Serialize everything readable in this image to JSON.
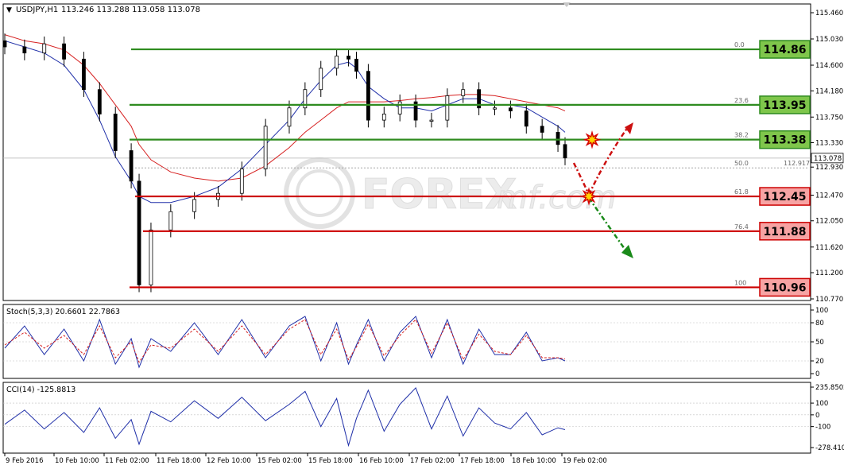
{
  "header": {
    "menu_glyph": "▼",
    "symbol": "USDJPY,H1",
    "ohlc": "113.246 113.288 113.058 113.078"
  },
  "watermark": {
    "brand": "FOREX",
    "suffix": "mf.com"
  },
  "colors": {
    "up_line": "#2e8b1f",
    "down_line": "#cc0000",
    "up_box": "#7fc64b",
    "down_box": "#f7a3a3",
    "ma_fast": "#1f2fa8",
    "ma_slow": "#d62020",
    "stoch_main": "#1f2fa8",
    "stoch_signal": "#d62020",
    "cci": "#1f2fa8",
    "arrow_up": "#cc1010",
    "arrow_down": "#1a8a1a"
  },
  "price_axis": {
    "ticks": [
      "115.460",
      "115.030",
      "114.600",
      "114.180",
      "113.750",
      "113.330",
      "112.930",
      "112.470",
      "112.050",
      "111.620",
      "111.200",
      "110.770"
    ],
    "current": "113.078",
    "dotted_level": "112.917"
  },
  "fib_levels": [
    {
      "pct": "0.0",
      "price": 114.86,
      "label": "114.86",
      "color": "up"
    },
    {
      "pct": "23.6",
      "price": 113.95,
      "label": "113.95",
      "color": "up"
    },
    {
      "pct": "38.2",
      "price": 113.38,
      "label": "113.38",
      "color": "up"
    },
    {
      "pct": "50.0",
      "price": 112.917,
      "label": "",
      "color": "none"
    },
    {
      "pct": "61.8",
      "price": 112.45,
      "label": "112.45",
      "color": "down"
    },
    {
      "pct": "76.4",
      "price": 111.88,
      "label": "111.88",
      "color": "down"
    },
    {
      "pct": "100",
      "price": 110.96,
      "label": "110.96",
      "color": "down"
    }
  ],
  "stoch": {
    "title": "Stoch(5,3,3) 20.6601 22.7863",
    "ticks": [
      "100",
      "80",
      "50",
      "20",
      "0"
    ]
  },
  "cci": {
    "title": "CCI(14) -125.8813",
    "ticks": [
      "235.8502",
      "100",
      "0",
      "-100",
      "-278.4105"
    ]
  },
  "time_axis": [
    "9 Feb 2016",
    "10 Feb 10:00",
    "11 Feb 02:00",
    "11 Feb 18:00",
    "12 Feb 10:00",
    "15 Feb 02:00",
    "15 Feb 18:00",
    "16 Feb 10:00",
    "17 Feb 02:00",
    "17 Feb 18:00",
    "18 Feb 10:00",
    "19 Feb 02:00"
  ],
  "chart_data": {
    "type": "line",
    "subtype": "candlestick",
    "symbol": "USDJPY",
    "timeframe": "H1",
    "ylim": [
      110.77,
      115.46
    ],
    "x": [
      0,
      25,
      50,
      75,
      100,
      120,
      140,
      160,
      170,
      185,
      210,
      240,
      270,
      300,
      330,
      360,
      380,
      400,
      420,
      435,
      445,
      460,
      480,
      500,
      520,
      540,
      560,
      580,
      600,
      620,
      640,
      660,
      680,
      700,
      709
    ],
    "close": [
      114.9,
      114.8,
      114.95,
      114.7,
      114.2,
      113.8,
      113.2,
      112.7,
      111.0,
      111.9,
      112.2,
      112.4,
      112.5,
      112.9,
      113.6,
      113.9,
      114.2,
      114.55,
      114.75,
      114.7,
      114.5,
      113.7,
      113.8,
      114.0,
      113.7,
      113.7,
      114.1,
      114.2,
      113.9,
      113.9,
      113.85,
      113.6,
      113.5,
      113.3,
      113.08
    ],
    "ma_fast": [
      115.0,
      114.9,
      114.8,
      114.6,
      114.2,
      113.7,
      113.1,
      112.7,
      112.45,
      112.35,
      112.35,
      112.45,
      112.6,
      112.9,
      113.3,
      113.7,
      114.05,
      114.35,
      114.6,
      114.65,
      114.55,
      114.25,
      114.05,
      113.9,
      113.9,
      113.85,
      113.95,
      114.05,
      114.05,
      113.95,
      113.95,
      113.9,
      113.75,
      113.6,
      113.5
    ],
    "ma_slow": [
      115.1,
      115.0,
      114.95,
      114.85,
      114.6,
      114.3,
      113.95,
      113.6,
      113.3,
      113.05,
      112.85,
      112.75,
      112.7,
      112.75,
      112.95,
      113.25,
      113.5,
      113.7,
      113.9,
      114.0,
      114.0,
      114.0,
      114.0,
      114.02,
      114.05,
      114.07,
      114.1,
      114.12,
      114.12,
      114.1,
      114.05,
      114.0,
      113.95,
      113.9,
      113.85
    ],
    "stoch_k": [
      40,
      75,
      30,
      70,
      20,
      85,
      15,
      55,
      10,
      55,
      35,
      80,
      30,
      85,
      25,
      75,
      90,
      20,
      80,
      15,
      45,
      85,
      20,
      65,
      90,
      25,
      85,
      15,
      70,
      30,
      30,
      65,
      20,
      25,
      20
    ],
    "stoch_d": [
      45,
      65,
      40,
      60,
      30,
      75,
      25,
      50,
      18,
      45,
      40,
      70,
      35,
      75,
      30,
      70,
      85,
      30,
      70,
      22,
      42,
      78,
      28,
      60,
      85,
      32,
      80,
      22,
      62,
      35,
      30,
      60,
      25,
      25,
      23
    ],
    "cci": [
      -80,
      40,
      -120,
      20,
      -150,
      60,
      -200,
      -40,
      -250,
      30,
      -60,
      120,
      -30,
      150,
      -50,
      90,
      200,
      -100,
      140,
      -260,
      -30,
      210,
      -140,
      90,
      230,
      -120,
      160,
      -180,
      60,
      -70,
      -120,
      20,
      -170,
      -110,
      -126
    ],
    "cci_ylim": [
      -278.4105,
      235.8502
    ],
    "annotations": [
      "Fib 0.0 114.86",
      "Fib 23.6 113.95",
      "Fib 38.2 113.38",
      "Fib 50.0",
      "Fib 61.8 112.45",
      "Fib 76.4 111.88",
      "Fib 100 110.96"
    ]
  }
}
